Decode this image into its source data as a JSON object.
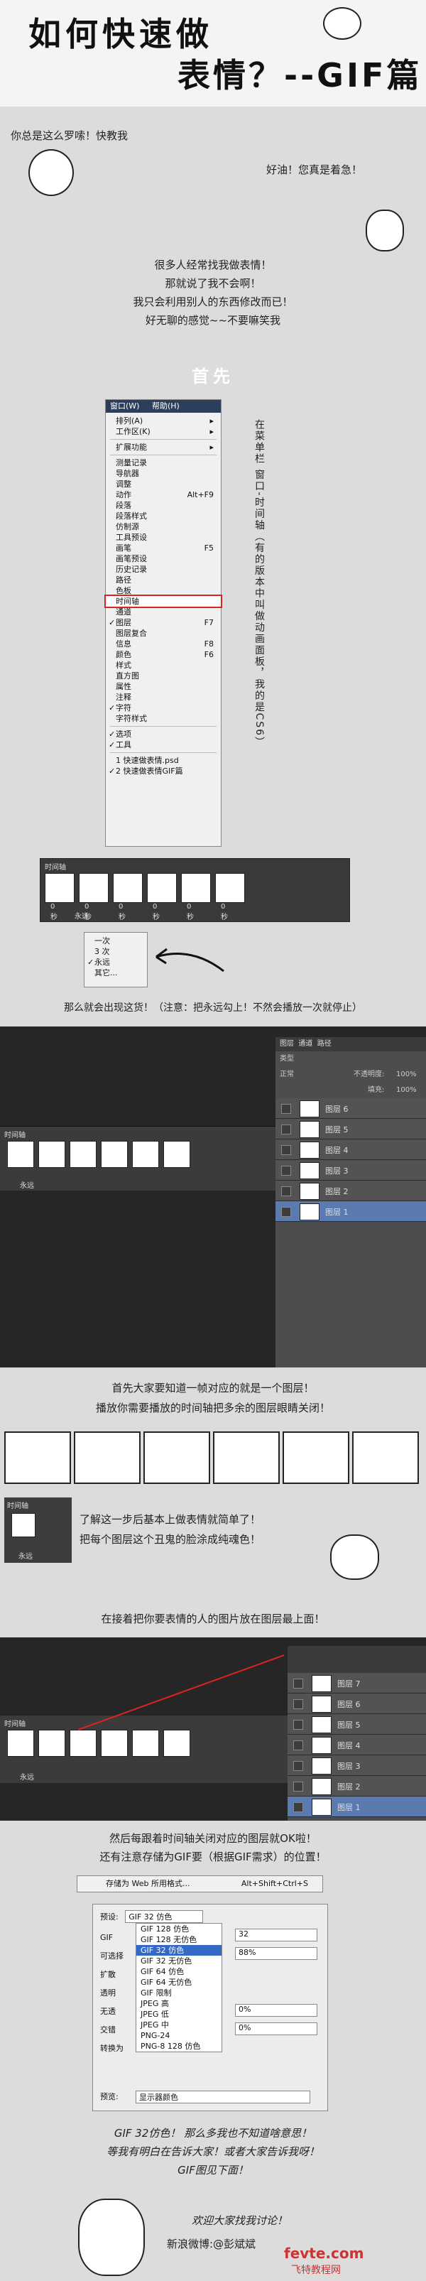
{
  "title": {
    "line1": "如何快速做",
    "line2": "表情？--GIF篇"
  },
  "intro": {
    "bubble_left": "你总是这么罗嗦！快教我",
    "bubble_right": "好油！您真是着急！",
    "paragraph": [
      "很多人经常找我做表情！",
      "那就说了我不会啊！",
      "我只会利用别人的东西修改而已！",
      "好无聊的感觉~~不要嘛笑我"
    ]
  },
  "step_heading": "首先",
  "menu": {
    "header_left": "窗口(W)",
    "header_right": "帮助(H)",
    "items": [
      {
        "label": "排列(A)",
        "shortcut": "▸"
      },
      {
        "label": "工作区(K)",
        "shortcut": "▸"
      },
      {
        "label": "SEP"
      },
      {
        "label": "扩展功能",
        "shortcut": "▸"
      },
      {
        "label": "SEP"
      },
      {
        "label": "测量记录",
        "shortcut": ""
      },
      {
        "label": "导航器",
        "shortcut": ""
      },
      {
        "label": "调整",
        "shortcut": ""
      },
      {
        "label": "动作",
        "shortcut": "Alt+F9"
      },
      {
        "label": "段落",
        "shortcut": ""
      },
      {
        "label": "段落样式",
        "shortcut": ""
      },
      {
        "label": "仿制源",
        "shortcut": ""
      },
      {
        "label": "工具预设",
        "shortcut": ""
      },
      {
        "label": "画笔",
        "shortcut": "F5"
      },
      {
        "label": "画笔预设",
        "shortcut": ""
      },
      {
        "label": "历史记录",
        "shortcut": ""
      },
      {
        "label": "路径",
        "shortcut": ""
      },
      {
        "label": "色板",
        "shortcut": ""
      },
      {
        "label": "时间轴",
        "shortcut": "",
        "highlight": true
      },
      {
        "label": "通道",
        "shortcut": ""
      },
      {
        "label": "图层",
        "shortcut": "F7",
        "check": true
      },
      {
        "label": "图层复合",
        "shortcut": ""
      },
      {
        "label": "信息",
        "shortcut": "F8"
      },
      {
        "label": "颜色",
        "shortcut": "F6"
      },
      {
        "label": "样式",
        "shortcut": ""
      },
      {
        "label": "直方图",
        "shortcut": ""
      },
      {
        "label": "属性",
        "shortcut": ""
      },
      {
        "label": "注释",
        "shortcut": ""
      },
      {
        "label": "字符",
        "shortcut": "",
        "check": true
      },
      {
        "label": "字符样式",
        "shortcut": ""
      },
      {
        "label": "SEP"
      },
      {
        "label": "选项",
        "shortcut": "",
        "check": true
      },
      {
        "label": "工具",
        "shortcut": "",
        "check": true
      },
      {
        "label": "SEP"
      },
      {
        "label": "1 快速做表情.psd",
        "shortcut": ""
      },
      {
        "label": "2 快速做表情GIF篇",
        "shortcut": "",
        "check": true
      }
    ]
  },
  "side_note": "在菜单栏 窗口-时间轴（有的版本中叫做动画面板，我的是CS6）",
  "timeline1": {
    "title": "时间轴",
    "frames": [
      "0秒",
      "0秒",
      "0秒",
      "0秒",
      "0秒",
      "0秒"
    ],
    "loop": "永远"
  },
  "loop_menu": {
    "items": [
      "一次",
      "3 次",
      "永远",
      "其它..."
    ]
  },
  "note_loop": "那么就会出现这货！（注意：把永远勾上！不然会播放一次就停止）",
  "ps_window": {
    "layers_tabs": [
      "图层",
      "通道",
      "路径"
    ],
    "opacity_label": "不透明度:",
    "opacity": "100%",
    "fill_label": "填充:",
    "fill": "100%",
    "blend": "正常",
    "kind": "类型",
    "layers": [
      "图层 6",
      "图层 5",
      "图层 4",
      "图层 3",
      "图层 2",
      "图层 1"
    ],
    "timeline_title": "时间轴",
    "loop": "永远"
  },
  "note_layers": [
    "首先大家要知道一帧对应的就是一个图层！",
    "播放你需要播放的时间轴把多余的图层眼睛关闭！"
  ],
  "note_simple": [
    "了解这一步后基本上做表情就简单了！",
    "把每个图层这个丑鬼的脸涂成纯魂色！"
  ],
  "small_timeline": {
    "title": "时间轴",
    "loop": "永远"
  },
  "note_top": "在接着把你要表情的人的图片放在图层最上面！",
  "ps_window2": {
    "layers": [
      "图层 7",
      "图层 6",
      "图层 5",
      "图层 4",
      "图层 3",
      "图层 2",
      "图层 1"
    ],
    "timeline_title": "时间轴",
    "loop": "永远"
  },
  "note_save": [
    "然后每跟着时间轴关闭对应的图层就OK啦！",
    "还有注意存储为GIF要（根据GIF需求）的位置！"
  ],
  "save_menu": {
    "label": "存储为 Web 所用格式...",
    "shortcut": "Alt+Shift+Ctrl+S"
  },
  "save_dialog": {
    "preset_label": "预设:",
    "preset_value": "GIF 32 仿色",
    "options": [
      "GIF 128 仿色",
      "GIF 128 无仿色",
      "GIF 32 仿色",
      "GIF 32 无仿色",
      "GIF 64 仿色",
      "GIF 64 无仿色",
      "GIF 限制",
      "JPEG 高",
      "JPEG 低",
      "JPEG 中",
      "PNG-24",
      "PNG-8 128 仿色"
    ],
    "labels": [
      "GIF",
      "可选择",
      "扩散",
      "透明",
      "无透",
      "交错",
      "转换为",
      "预览:"
    ],
    "colors_value": "32",
    "dither_value": "88%",
    "side_value": "0%",
    "web_value": "0%",
    "preview_value": "显示器颜色"
  },
  "note_end": [
    "GIF 32仿色！ 那么多我也不知道啥意思！",
    "等我有明白在告诉大家！或者大家告诉我呀！",
    "GIF图见下面！"
  ],
  "footer": {
    "line1": "欢迎大家找我讨论！",
    "line2": "新浪微博:@彭斌斌",
    "watermark1": "fevte.com",
    "watermark2": "飞特教程网"
  }
}
